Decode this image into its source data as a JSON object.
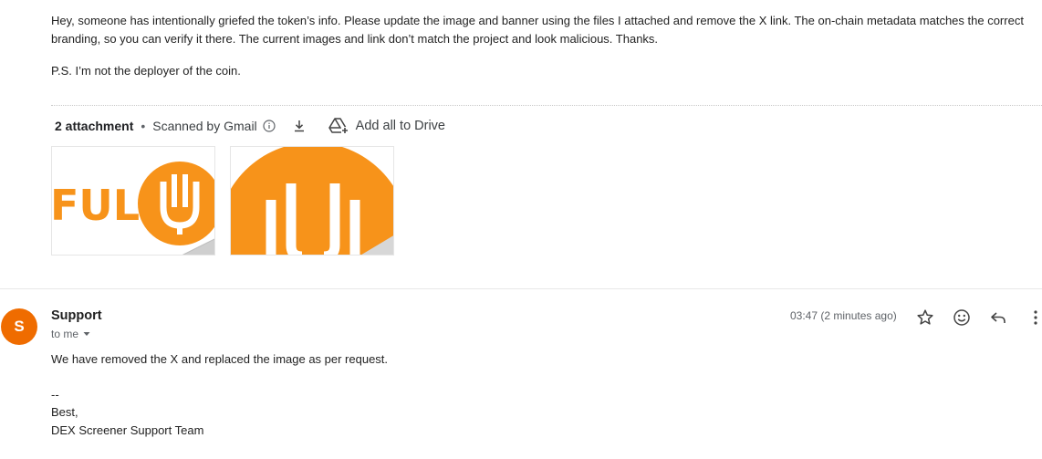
{
  "message1": {
    "paragraph1": "Hey, someone has intentionally griefed the token’s info. Please update the image and banner using the files I attached and remove the X link. The on-chain metadata matches the correct branding, so you can verify it there. The current images and link don’t match the project and look malicious. Thanks.",
    "paragraph2": "P.S. I’m not the deployer of the coin.",
    "attachments": {
      "count_label": "2 attachment",
      "separator": "•",
      "scanned_label": "Scanned by Gmail",
      "add_drive_label": "Add all to Drive",
      "thumb1_text": "FUL"
    }
  },
  "message2": {
    "avatar_letter": "S",
    "sender": "Support",
    "recipient": "to me",
    "time": "03:47 (2 minutes ago)",
    "body": "We have removed the X and replaced the image as per request.",
    "signature_dashes": "--",
    "signature_best": "Best,",
    "signature_team": "DEX Screener Support Team"
  },
  "colors": {
    "brand_orange": "#f7931a",
    "avatar_orange": "#ef6c00"
  },
  "icons": [
    "info-icon",
    "download-icon",
    "add-to-drive-icon",
    "chevron-down-icon",
    "star-icon",
    "emoji-icon",
    "reply-icon",
    "more-vert-icon"
  ]
}
